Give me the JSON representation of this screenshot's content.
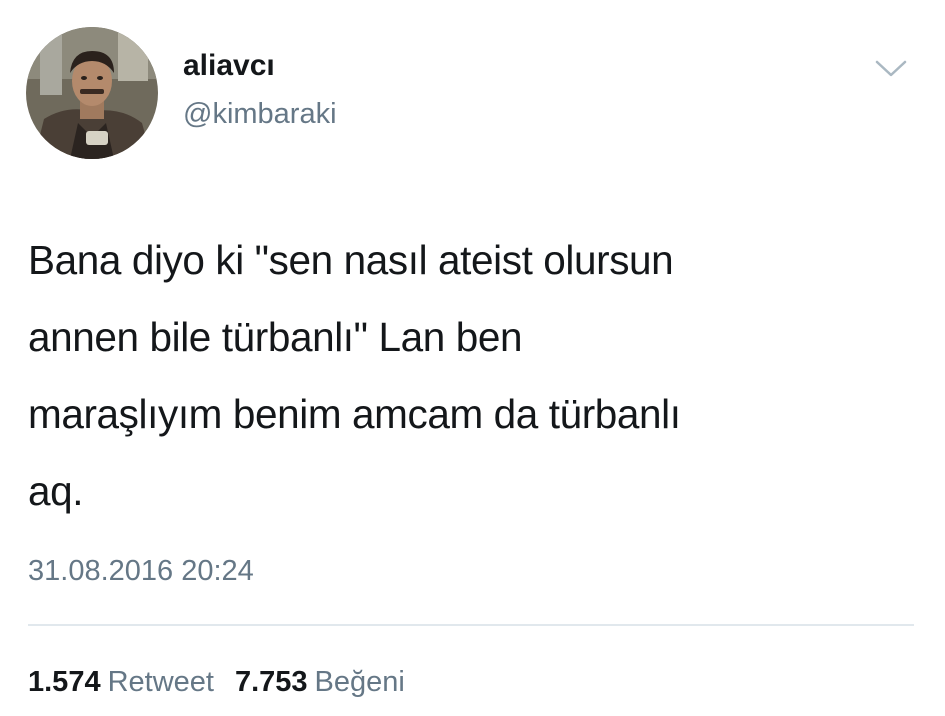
{
  "tweet": {
    "author": {
      "display_name": "aliavcı",
      "handle": "@kimbaraki"
    },
    "text": "Bana diyo ki \"sen nasıl ateist olursun\nannen bile türbanlı\" Lan ben\nmaraşlıyım benim amcam da türbanlı\naq.",
    "timestamp": "31.08.2016 20:24",
    "stats": {
      "retweets": {
        "count": "1.574",
        "label": "Retweet"
      },
      "likes": {
        "count": "7.753",
        "label": "Beğeni"
      }
    }
  },
  "icons": {
    "menu": "chevron-down-icon"
  },
  "colors": {
    "text": "#14171a",
    "secondary_text": "#657786",
    "divider": "#e1e8ed"
  }
}
